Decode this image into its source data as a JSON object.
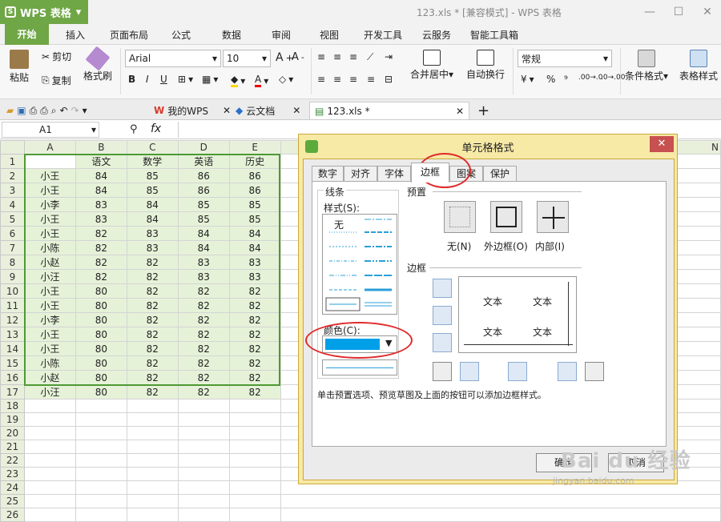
{
  "app": {
    "logo_label": "WPS 表格",
    "doc_title": "123.xls * [兼容模式] - WPS 表格"
  },
  "ribbon": {
    "tabs": [
      "开始",
      "插入",
      "页面布局",
      "公式",
      "数据",
      "审阅",
      "视图",
      "开发工具",
      "云服务",
      "智能工具箱"
    ]
  },
  "toolbar": {
    "paste": "粘贴",
    "cut": "剪切",
    "copy": "复制",
    "format_painter": "格式刷",
    "font_name": "Arial",
    "font_size": "10",
    "merge": "合并居中",
    "wrap": "自动换行",
    "number_format": "常规",
    "percent": "%",
    "comma": "⁹",
    "dec_inc": ".00→.0",
    "dec_dec": ".0→.00",
    "cond_format": "条件格式",
    "table_style": "表格样式",
    "bold": "B",
    "italic": "I",
    "underline": "U"
  },
  "doc_tabs": {
    "mywps": "我的WPS",
    "cloud": "云文档",
    "file": "123.xls *"
  },
  "formula_bar": {
    "name_box": "A1",
    "fx": "fx"
  },
  "sheet": {
    "columns": [
      "A",
      "B",
      "C",
      "D",
      "E"
    ],
    "extra_col": "N",
    "header_row": [
      "",
      "语文",
      "数学",
      "英语",
      "历史"
    ],
    "rows": [
      [
        "小王",
        "84",
        "85",
        "86",
        "86"
      ],
      [
        "小王",
        "84",
        "85",
        "86",
        "86"
      ],
      [
        "小李",
        "83",
        "84",
        "85",
        "85"
      ],
      [
        "小王",
        "83",
        "84",
        "85",
        "85"
      ],
      [
        "小王",
        "82",
        "83",
        "84",
        "84"
      ],
      [
        "小陈",
        "82",
        "83",
        "84",
        "84"
      ],
      [
        "小赵",
        "82",
        "82",
        "83",
        "83"
      ],
      [
        "小汪",
        "82",
        "82",
        "83",
        "83"
      ],
      [
        "小王",
        "80",
        "82",
        "82",
        "82"
      ],
      [
        "小王",
        "80",
        "82",
        "82",
        "82"
      ],
      [
        "小李",
        "80",
        "82",
        "82",
        "82"
      ],
      [
        "小王",
        "80",
        "82",
        "82",
        "82"
      ],
      [
        "小王",
        "80",
        "82",
        "82",
        "82"
      ],
      [
        "小陈",
        "80",
        "82",
        "82",
        "82"
      ],
      [
        "小赵",
        "80",
        "82",
        "82",
        "82"
      ],
      [
        "小汪",
        "80",
        "82",
        "82",
        "82"
      ]
    ],
    "row_numbers": [
      "1",
      "2",
      "3",
      "4",
      "5",
      "6",
      "7",
      "8",
      "9",
      "10",
      "11",
      "12",
      "13",
      "14",
      "15",
      "16",
      "17",
      "18",
      "19",
      "20",
      "21",
      "22",
      "23",
      "24",
      "25",
      "26"
    ]
  },
  "dialog": {
    "title": "单元格格式",
    "tabs": [
      "数字",
      "对齐",
      "字体",
      "边框",
      "图案",
      "保护"
    ],
    "active_tab": "边框",
    "line_group": "线条",
    "style_label": "样式(S):",
    "style_none": "无",
    "color_label": "颜色(C):",
    "color_value": "#00a0e9",
    "preset_label": "预置",
    "presets": [
      "无(N)",
      "外边框(O)",
      "内部(I)"
    ],
    "border_label": "边框",
    "preview_text": [
      "文本",
      "文本",
      "文本",
      "文本"
    ],
    "hint": "单击预置选项、预览草图及上面的按钮可以添加边框样式。",
    "ok": "确定",
    "cancel": "取消"
  },
  "watermark": {
    "line1": "Bai du 经验",
    "line2": "jingyan.baidu.com"
  },
  "colors": {
    "accent": "#6fa646",
    "selection": "#4e9a34",
    "highlight": "#e02a2a"
  }
}
